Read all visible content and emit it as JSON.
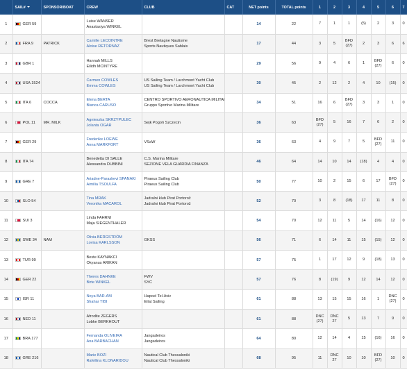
{
  "headers": {
    "rank": "",
    "sail": "SAIL#",
    "sponsor": "SPONSOR/BOAT",
    "crew": "CREW",
    "club": "CLUB",
    "cat": "CAT",
    "net": "NET points",
    "total": "TOTAL points",
    "races": [
      "1",
      "2",
      "3",
      "4",
      "5",
      "6",
      "7"
    ]
  },
  "rows": [
    {
      "rank": "1",
      "flag_colors": [
        "#000000",
        "#dd0000",
        "#ffce00"
      ],
      "sail": "GER 59",
      "sponsor": "",
      "crew": [
        "Luise WANSER",
        "Anastasiya WINKEL"
      ],
      "crew_link": false,
      "club": [
        "",
        ""
      ],
      "net": "14",
      "total": "22",
      "races": [
        [
          "7"
        ],
        [
          "1"
        ],
        [
          "1"
        ],
        [
          "(5)"
        ],
        [
          "2"
        ],
        [
          "3"
        ],
        [
          "0"
        ]
      ]
    },
    {
      "rank": "2",
      "flag_colors": [
        "#0055a4",
        "#ffffff",
        "#ef4135"
      ],
      "sail": "FRA 9",
      "sponsor": "PATRICK",
      "crew": [
        "Camille LECOINTRE",
        "Aloise RETORNAZ"
      ],
      "crew_link": true,
      "club": [
        "Brest Bretagne Nautisme",
        "Sports Nautiques Sablais"
      ],
      "net": "17",
      "total": "44",
      "races": [
        [
          "3"
        ],
        [
          "5"
        ],
        [
          "BFD",
          "(27)"
        ],
        [
          "2"
        ],
        [
          "3"
        ],
        [
          "6"
        ],
        [
          "6"
        ]
      ]
    },
    {
      "rank": "3",
      "flag_colors": [
        "#c8102e",
        "#ffffff",
        "#012169"
      ],
      "sail": "GBR 1",
      "sponsor": "",
      "crew": [
        "Hannah MILLS",
        "Eilidh MCINTYRE"
      ],
      "crew_link": false,
      "club": [
        "",
        ""
      ],
      "net": "29",
      "total": "56",
      "races": [
        [
          "9"
        ],
        [
          "4"
        ],
        [
          "6"
        ],
        [
          "1"
        ],
        [
          "BFD",
          "(27)"
        ],
        [
          "6"
        ],
        [
          "0"
        ]
      ]
    },
    {
      "rank": "4",
      "flag_colors": [
        "#b22234",
        "#ffffff",
        "#3c3b6e"
      ],
      "sail": "USA 1524",
      "sponsor": "",
      "crew": [
        "Carmen COWLES",
        "Emma COWLES"
      ],
      "crew_link": true,
      "club": [
        "US Sailing Team / Larchmont Yacht Club",
        "US Sailing Team / Larchmont Yacht Club"
      ],
      "net": "30",
      "total": "45",
      "races": [
        [
          "2"
        ],
        [
          "12"
        ],
        [
          "2"
        ],
        [
          "4"
        ],
        [
          "10"
        ],
        [
          "(15)"
        ],
        [
          "0"
        ]
      ]
    },
    {
      "rank": "5",
      "flag_colors": [
        "#009246",
        "#ffffff",
        "#ce2b37"
      ],
      "sail": "ITA 6",
      "sponsor": "COCCA",
      "crew": [
        "Elena BERTA",
        "Bianca CARUSO"
      ],
      "crew_link": true,
      "club": [
        "CENTRO SPORTIVO AERONAUTICA MILITARE",
        "Gruppo Sportivo Marina Militare"
      ],
      "net": "34",
      "total": "51",
      "races": [
        [
          "16"
        ],
        [
          "6"
        ],
        [
          "BFD",
          "(27)"
        ],
        [
          "3"
        ],
        [
          "3"
        ],
        [
          "1"
        ],
        [
          "0"
        ]
      ]
    },
    {
      "rank": "6",
      "flag_colors": [
        "#ffffff",
        "#dc143c",
        "#dc143c"
      ],
      "sail": "POL 11",
      "sponsor": "MR. MILK",
      "crew": [
        "Agnieszka SKRZYPULEC",
        "Jolanta OGAR"
      ],
      "crew_link": true,
      "club": [
        "Sejk Pogoń Szczecin",
        ""
      ],
      "net": "36",
      "total": "63",
      "races": [
        [
          "BFD",
          "(27)"
        ],
        [
          "5"
        ],
        [
          "16"
        ],
        [
          "7"
        ],
        [
          "6"
        ],
        [
          "2"
        ],
        [
          "0"
        ]
      ]
    },
    {
      "rank": "7",
      "flag_colors": [
        "#000000",
        "#dd0000",
        "#ffce00"
      ],
      "sail": "GER 29",
      "sponsor": "",
      "crew": [
        "Frederike LOEWE",
        "Anna MARKFORT"
      ],
      "crew_link": true,
      "club": [
        "VSaW",
        ""
      ],
      "net": "36",
      "total": "63",
      "races": [
        [
          "4"
        ],
        [
          "9"
        ],
        [
          "7"
        ],
        [
          "5"
        ],
        [
          "BFD",
          "(27)"
        ],
        [
          "11"
        ],
        [
          "0"
        ]
      ]
    },
    {
      "rank": "8",
      "flag_colors": [
        "#009246",
        "#ffffff",
        "#ce2b37"
      ],
      "sail": "ITA 74",
      "sponsor": "",
      "crew": [
        "Benedetta DI SALLE",
        "Alessandra DUBBINI"
      ],
      "crew_link": false,
      "club": [
        "C.S. Marina Militare",
        "SEZIONE VELA GUARDIA FINANZA"
      ],
      "net": "46",
      "total": "64",
      "races": [
        [
          "14"
        ],
        [
          "10"
        ],
        [
          "14"
        ],
        [
          "(18)"
        ],
        [
          "4"
        ],
        [
          "4"
        ],
        [
          "0"
        ]
      ]
    },
    {
      "rank": "9",
      "flag_colors": [
        "#0d5eaf",
        "#ffffff",
        "#0d5eaf"
      ],
      "sail": "GRE 7",
      "sponsor": "",
      "crew": [
        "Ariadne-Paraskevi SPANAKI",
        "Aimilia TSOULFA"
      ],
      "crew_link": true,
      "club": [
        "Piraeus Sailing Club",
        "Piraeus Sailing Club"
      ],
      "net": "50",
      "total": "77",
      "races": [
        [
          "10"
        ],
        [
          "2"
        ],
        [
          "15"
        ],
        [
          "6"
        ],
        [
          "17"
        ],
        [
          "BFD",
          "(27)"
        ],
        [
          "0"
        ]
      ]
    },
    {
      "rank": "10",
      "flag_colors": [
        "#ffffff",
        "#005da4",
        "#ed1c24"
      ],
      "sail": "SLO 54",
      "sponsor": "",
      "crew": [
        "Tina MRAK",
        "Veronika MACAROL"
      ],
      "crew_link": true,
      "club": [
        "Jadralni klub Pirat Portorož",
        "Jadralni klub Pirat Portorož"
      ],
      "net": "52",
      "total": "70",
      "races": [
        [
          "3"
        ],
        [
          "8"
        ],
        [
          "(18)"
        ],
        [
          "17"
        ],
        [
          "11"
        ],
        [
          "8"
        ],
        [
          "0"
        ]
      ]
    },
    {
      "rank": "11",
      "flag_colors": [
        "#ffffff",
        "#dc143c",
        "#dc143c"
      ],
      "sail": "SUI 3",
      "sponsor": "",
      "crew": [
        "Linda FAHRNI",
        "Maja SIEGENTHALER"
      ],
      "crew_link": false,
      "club": [
        "",
        ""
      ],
      "net": "54",
      "total": "70",
      "races": [
        [
          "12"
        ],
        [
          "11"
        ],
        [
          "5"
        ],
        [
          "14"
        ],
        [
          "(16)"
        ],
        [
          "12"
        ],
        [
          "0"
        ]
      ]
    },
    {
      "rank": "12",
      "flag_colors": [
        "#006aa7",
        "#fecc00",
        "#006aa7"
      ],
      "sail": "SWE 34",
      "sponsor": "NAM",
      "crew": [
        "Olivia BERGSTRÖM",
        "Lovisa KARLSSON"
      ],
      "crew_link": true,
      "club": [
        "GKSS",
        ""
      ],
      "net": "56",
      "total": "71",
      "races": [
        [
          "6"
        ],
        [
          "14"
        ],
        [
          "11"
        ],
        [
          "15"
        ],
        [
          "(15)"
        ],
        [
          "12"
        ],
        [
          "0"
        ]
      ]
    },
    {
      "rank": "13",
      "flag_colors": [
        "#e30a17",
        "#ffffff",
        "#e30a17"
      ],
      "sail": "TUR 99",
      "sponsor": "",
      "crew": [
        "Beste KAYNAKCI",
        "Okyanus ARIKAN"
      ],
      "crew_link": false,
      "club": [
        "",
        ""
      ],
      "net": "57",
      "total": "75",
      "races": [
        [
          "1"
        ],
        [
          "17"
        ],
        [
          "12"
        ],
        [
          "9"
        ],
        [
          "(18)"
        ],
        [
          "13"
        ],
        [
          "0"
        ]
      ]
    },
    {
      "rank": "14",
      "flag_colors": [
        "#000000",
        "#dd0000",
        "#ffce00"
      ],
      "sail": "GER 22",
      "sponsor": "",
      "crew": [
        "Theres DAHNKE",
        "Birte WINKEL"
      ],
      "crew_link": true,
      "club": [
        "FWV",
        "SYC"
      ],
      "net": "57",
      "total": "76",
      "races": [
        [
          "8"
        ],
        [
          "(19)"
        ],
        [
          "9"
        ],
        [
          "12"
        ],
        [
          "14"
        ],
        [
          "12"
        ],
        [
          "0"
        ]
      ]
    },
    {
      "rank": "15",
      "flag_colors": [
        "#ffffff",
        "#0038b8",
        "#ffffff"
      ],
      "sail": "ISR 11",
      "sponsor": "",
      "crew": [
        "Noya BAR-AM",
        "Shahar TIBI"
      ],
      "crew_link": true,
      "club": [
        "Hapoel Tel-Aviv",
        "Eilat Sailing"
      ],
      "net": "61",
      "total": "88",
      "races": [
        [
          "13"
        ],
        [
          "15"
        ],
        [
          "15"
        ],
        [
          "16"
        ],
        [
          "1"
        ],
        [
          "DNC",
          "(27)"
        ],
        [
          "0"
        ]
      ]
    },
    {
      "rank": "16",
      "flag_colors": [
        "#ae1c28",
        "#ffffff",
        "#21468b"
      ],
      "sail": "NED 11",
      "sponsor": "",
      "crew": [
        "Afrodite ZEGERS",
        "Lobke BERKHOUT"
      ],
      "crew_link": false,
      "club": [
        "",
        ""
      ],
      "net": "61",
      "total": "88",
      "races": [
        [
          "DNC",
          "(27)"
        ],
        [
          "DNC",
          "27"
        ],
        [
          "5"
        ],
        [
          "13"
        ],
        [
          "7"
        ],
        [
          "9"
        ],
        [
          "0"
        ]
      ]
    },
    {
      "rank": "17",
      "flag_colors": [
        "#009c3b",
        "#ffdf00",
        "#002776"
      ],
      "sail": "BRA 177",
      "sponsor": "",
      "crew": [
        "Fernanda OLIVEIRA",
        "Ana BARBACHAN"
      ],
      "crew_link": true,
      "club": [
        "Jangadeiros",
        "Jangadeiros"
      ],
      "net": "64",
      "total": "80",
      "races": [
        [
          "12"
        ],
        [
          "14"
        ],
        [
          "4"
        ],
        [
          "15"
        ],
        [
          "(16)"
        ],
        [
          "16"
        ],
        [
          "0"
        ]
      ]
    },
    {
      "rank": "18",
      "flag_colors": [
        "#0d5eaf",
        "#ffffff",
        "#0d5eaf"
      ],
      "sail": "GRE 216",
      "sponsor": "",
      "crew": [
        "Marie BOZI",
        "Rafellina KLONARIDOU"
      ],
      "crew_link": true,
      "club": [
        "Nautical Club Thessaloniki",
        "Nautical Club Thessaloniki"
      ],
      "net": "68",
      "total": "95",
      "races": [
        [
          "11"
        ],
        [
          "DNC",
          "27"
        ],
        [
          "10"
        ],
        [
          "10"
        ],
        [
          "BFD",
          "(27)"
        ],
        [
          "10"
        ],
        [
          "0"
        ]
      ]
    }
  ]
}
